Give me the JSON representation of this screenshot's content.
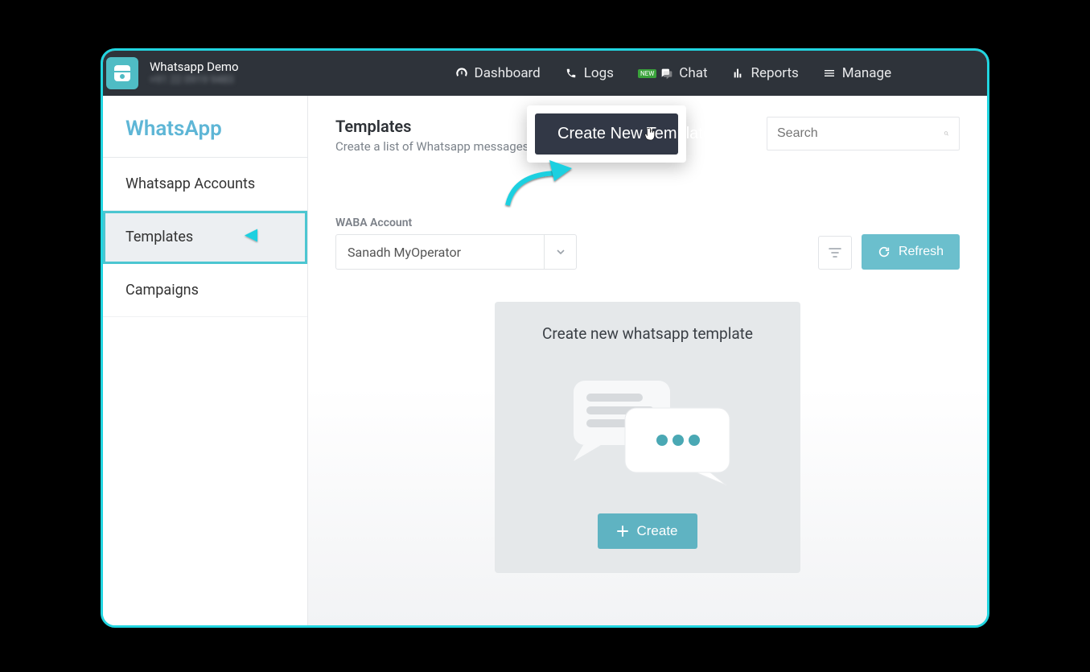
{
  "header": {
    "brand_title": "Whatsapp Demo",
    "brand_sub": "+91 22 0919 9483",
    "nav": {
      "dashboard": "Dashboard",
      "logs": "Logs",
      "chat": "Chat",
      "reports": "Reports",
      "manage": "Manage"
    }
  },
  "sidebar": {
    "title": "WhatsApp",
    "items": [
      {
        "label": "Whatsapp Accounts"
      },
      {
        "label": "Templates"
      },
      {
        "label": "Campaigns"
      }
    ]
  },
  "page": {
    "title": "Templates",
    "subtitle": "Create a list of Whatsapp messages",
    "search_placeholder": "Search",
    "create_button": "Create New Template",
    "waba_label": "WABA Account",
    "waba_selected": "Sanadh MyOperator",
    "refresh_label": "Refresh",
    "empty_title": "Create new whatsapp template",
    "empty_create": "Create"
  },
  "colors": {
    "accent": "#5eb6d6",
    "teal_button": "#6bbfcd",
    "highlight_border": "#21d5e0"
  }
}
